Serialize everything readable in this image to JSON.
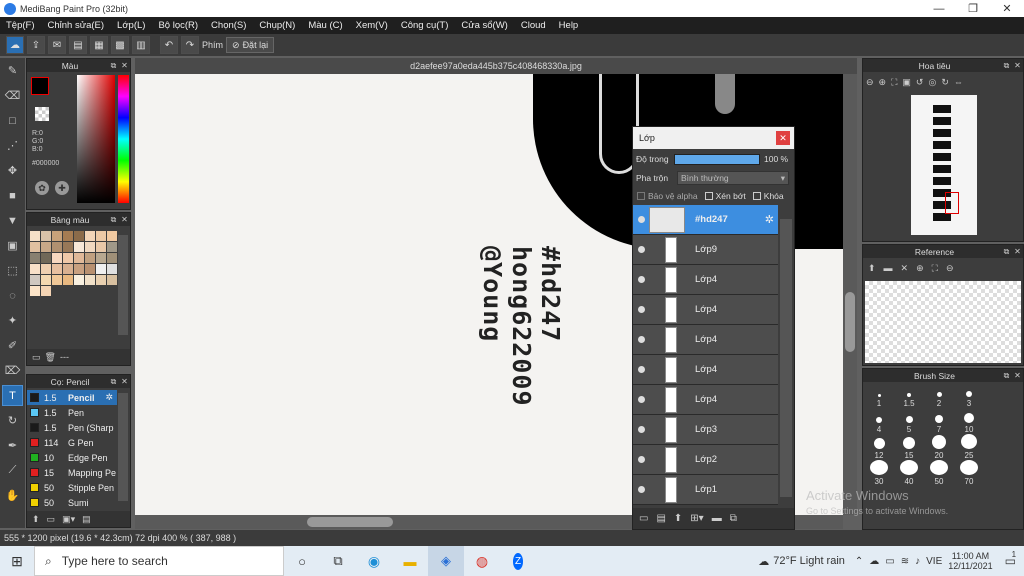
{
  "window": {
    "title": "MediBang Paint Pro (32bit)",
    "minimize": "—",
    "maximize": "❐",
    "close": "✕"
  },
  "menu": [
    "Tệp(F)",
    "Chỉnh sửa(E)",
    "Lớp(L)",
    "Bộ lọc(R)",
    "Chọn(S)",
    "Chụp(N)",
    "Màu (C)",
    "Xem(V)",
    "Công cụ(T)",
    "Cửa sổ(W)",
    "Cloud",
    "Help"
  ],
  "toolbar": {
    "snap_label": "Phím",
    "reset_label": "Đặt lại"
  },
  "color_panel": {
    "title": "Màu",
    "r": "R:0",
    "g": "G:0",
    "b": "B:0",
    "hex": "#000000",
    "primary_color": "#000000",
    "secondary_color": "#ffffff"
  },
  "palette_panel": {
    "title": "Bảng màu",
    "footer": "---",
    "swatches": [
      "#f5e0c8",
      "#d9c2a8",
      "#c8a27a",
      "#a67c52",
      "#8b6b4a",
      "#f2d5b8",
      "#ecc9a5",
      "#f1c9a0",
      "#e0c0a0",
      "#c8a888",
      "#b09070",
      "#987858",
      "#f8e8d8",
      "#f0d8c0",
      "#e8c8a8",
      "#a09888",
      "#888070",
      "#706858",
      "#f8d8c0",
      "#f0c8a8",
      "#e0b898",
      "#c0a080",
      "#b8a890",
      "#a09078",
      "#f8e0c8",
      "#f0d0b0",
      "#e8c0a0",
      "#d8b090",
      "#c8a080",
      "#b89070",
      "#f0f0f0",
      "#e0e0e0",
      "#d0c8c0",
      "#f4d8b0",
      "#f0c898",
      "#e8b880",
      "#f8f0e0",
      "#f0e0c8",
      "#e8d0b0",
      "#d8c0a0",
      "#fce4c8",
      "#f4d4b4"
    ]
  },
  "brush_panel": {
    "title": "Cọ: Pencil",
    "brushes": [
      {
        "size": "1.5",
        "name": "Pencil",
        "color": "#1a1a1a",
        "selected": true
      },
      {
        "size": "1.5",
        "name": "Pen",
        "color": "#5bc8f5",
        "selected": false
      },
      {
        "size": "1.5",
        "name": "Pen (Sharp",
        "color": "#1a1a1a",
        "selected": false
      },
      {
        "size": "114",
        "name": "G Pen",
        "color": "#e02020",
        "selected": false
      },
      {
        "size": "10",
        "name": "Edge Pen",
        "color": "#20b020",
        "selected": false
      },
      {
        "size": "15",
        "name": "Mapping Pe",
        "color": "#e02020",
        "selected": false
      },
      {
        "size": "50",
        "name": "Stipple Pen",
        "color": "#f0d000",
        "selected": false
      },
      {
        "size": "50",
        "name": "Sumi",
        "color": "#f0d000",
        "selected": false
      }
    ]
  },
  "canvas": {
    "filename": "d2aefee97a0eda445b375c408468330a.jpg",
    "text_lines": [
      "#hd247",
      "hong622009",
      "@Young"
    ]
  },
  "layer_panel": {
    "title": "Lớp",
    "opacity_label": "Độ trong",
    "opacity_value": "100 %",
    "opacity_fraction": 1.0,
    "blend_label": "Pha trộn",
    "blend_value": "Bình thường",
    "protect_alpha": "Bảo vệ alpha",
    "clip": "Xén bớt",
    "lock": "Khóa",
    "layers": [
      {
        "name": "#hd247",
        "selected": true
      },
      {
        "name": "Lớp9",
        "selected": false
      },
      {
        "name": "Lớp4",
        "selected": false
      },
      {
        "name": "Lớp4",
        "selected": false
      },
      {
        "name": "Lớp4",
        "selected": false
      },
      {
        "name": "Lớp4",
        "selected": false
      },
      {
        "name": "Lớp4",
        "selected": false
      },
      {
        "name": "Lớp3",
        "selected": false
      },
      {
        "name": "Lớp2",
        "selected": false
      },
      {
        "name": "Lớp1",
        "selected": false
      }
    ]
  },
  "navigator": {
    "title": "Hoa tiêu"
  },
  "reference": {
    "title": "Reference"
  },
  "brush_size": {
    "title": "Brush Size",
    "sizes": [
      "1",
      "1.5",
      "2",
      "3",
      "4",
      "5",
      "7",
      "10",
      "12",
      "15",
      "20",
      "25",
      "30",
      "40",
      "50",
      "70"
    ]
  },
  "status": {
    "text": "555 * 1200 pixel   (19.6 * 42.3cm)   72 dpi   400 %   ( 387, 988 )"
  },
  "watermark": {
    "line1": "Activate Windows",
    "line2": "Go to Settings to activate Windows."
  },
  "taskbar": {
    "search_placeholder": "Type here to search",
    "weather": "72°F  Light rain",
    "lang": "VIE",
    "time": "11:00 AM",
    "date": "12/11/2021",
    "notif": "1"
  }
}
